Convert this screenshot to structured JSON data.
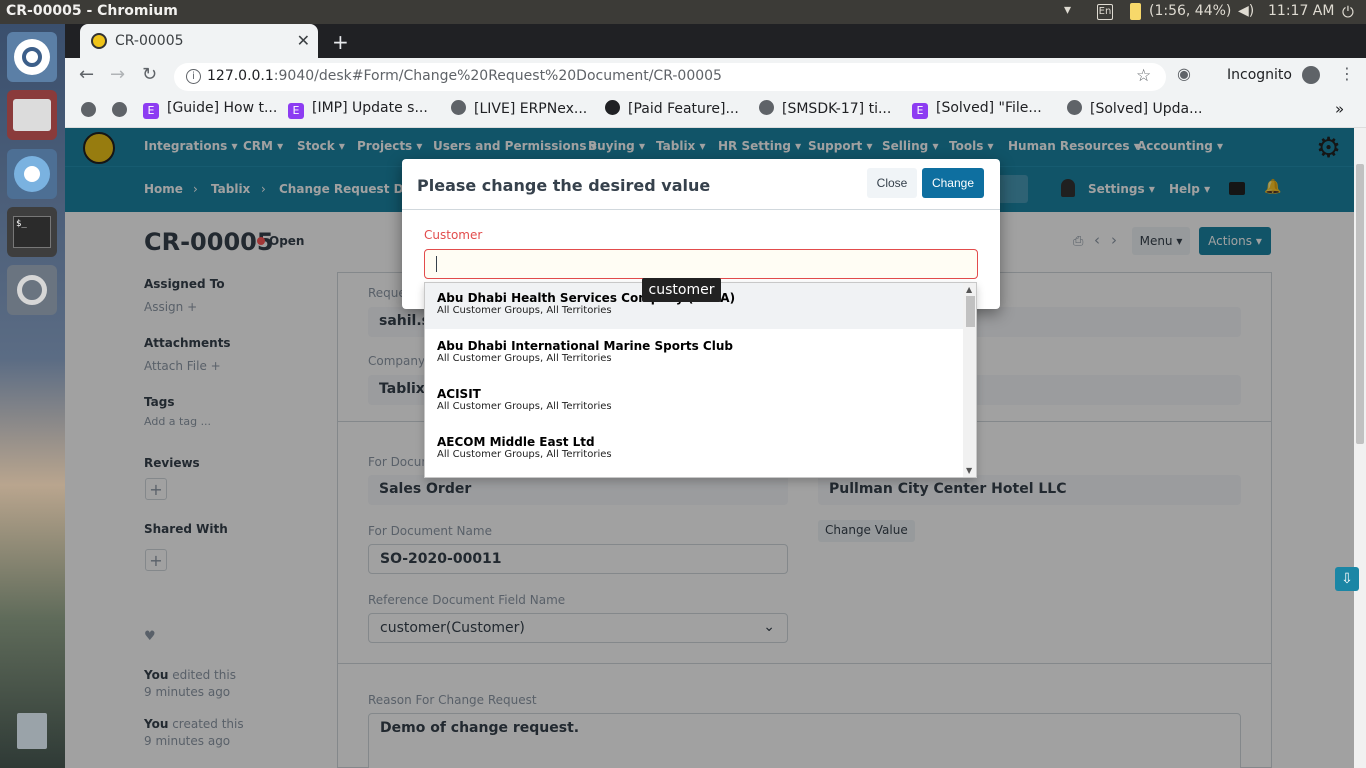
{
  "os": {
    "window_title": "CR-00005 - Chromium",
    "keyboard": "En",
    "battery": "(1:56, 44%)",
    "clock": "11:17 AM"
  },
  "browser": {
    "tab_title": "CR-00005",
    "url_host": "127.0.0.1",
    "url_rest": ":9040/desk#Form/Change%20Request%20Document/CR-00005",
    "incognito": "Incognito",
    "bookmarks": [
      "[Guide] How t...",
      "[IMP] Update s...",
      "[LIVE] ERPNex...",
      "[Paid Feature]...",
      "[SMSDK-17] ti...",
      "[Solved] \"File...",
      "[Solved] Upda..."
    ]
  },
  "nav": [
    "Integrations",
    "CRM",
    "Stock",
    "Projects",
    "Users and Permissions",
    "Buying",
    "Tablix",
    "HR Setting",
    "Support",
    "Selling",
    "Tools",
    "Human Resources",
    "Accounting"
  ],
  "breadcrumb": [
    "Home",
    "Tablix",
    "Change Request Doc..."
  ],
  "subnav": {
    "settings": "Settings",
    "help": "Help"
  },
  "page": {
    "title": "CR-00005",
    "status": "Open",
    "menu": "Menu",
    "actions": "Actions"
  },
  "sidebar": {
    "assigned_to": "Assigned To",
    "assign": "Assign",
    "attachments": "Attachments",
    "attach_file": "Attach File",
    "tags": "Tags",
    "add_tag": "Add a tag ...",
    "reviews": "Reviews",
    "shared_with": "Shared With",
    "activity1_user": "You",
    "activity1_text": "edited this",
    "activity1_time": "9 minutes ago",
    "activity2_user": "You",
    "activity2_text": "created this",
    "activity2_time": "9 minutes ago"
  },
  "form": {
    "requested_by_label": "Reque",
    "requested_by_value": "sahil.sa",
    "company_label": "Company",
    "company_value": "Tablix T",
    "for_doctype_label": "For Docum",
    "for_doctype_value": "Sales Order",
    "right_value": "Pullman City Center Hotel LLC",
    "change_value_btn": "Change Value",
    "for_doc_name_label": "For Document Name",
    "for_doc_name_value": "SO-2020-00011",
    "ref_field_label": "Reference Document Field Name",
    "ref_field_value": "customer(Customer)",
    "reason_label": "Reason For Change Request",
    "reason_value": "Demo of change request."
  },
  "modal": {
    "title": "Please change the desired value",
    "close": "Close",
    "change": "Change",
    "field_label": "Customer",
    "input_value": "",
    "tooltip": "customer",
    "options": [
      {
        "name": "Abu Dhabi Health Services Company (SEHA)",
        "desc": "All Customer Groups, All Territories"
      },
      {
        "name": "Abu Dhabi International Marine Sports Club",
        "desc": "All Customer Groups, All Territories"
      },
      {
        "name": "ACISIT",
        "desc": "All Customer Groups, All Territories"
      },
      {
        "name": "AECOM Middle East Ltd",
        "desc": "All Customer Groups, All Territories"
      }
    ]
  }
}
